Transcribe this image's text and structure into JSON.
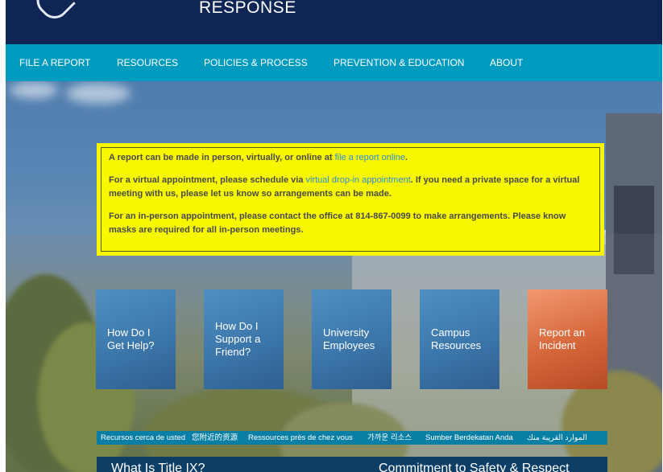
{
  "header": {
    "title": "RESPONSE",
    "logo_icon": "shield-logo-icon",
    "background": "#0f2554"
  },
  "nav": {
    "background": "#019bc0",
    "items": [
      {
        "label": "FILE A REPORT"
      },
      {
        "label": "RESOURCES"
      },
      {
        "label": "POLICIES & PROCESS"
      },
      {
        "label": "PREVENTION & EDUCATION"
      },
      {
        "label": "ABOUT"
      }
    ]
  },
  "notice": {
    "background": "#f7f700",
    "p1_text": "A report can be made in person, virtually, or online at ",
    "p1_link": "file a report online",
    "p1_end": ".",
    "p2_text": "For a virtual appointment, please schedule via ",
    "p2_link": "virtual drop-in appointment",
    "p2_end": ". If you need a private space for a virtual meeting with us, please let us know so arrangements can be made.",
    "p3_text": "For an in-person appointment, please contact the office at 814-867-0099 to make arrangements.  Please know masks are required for all in-person meetings."
  },
  "tiles": [
    {
      "label": "How Do I\nGet Help?",
      "color": "blue"
    },
    {
      "label": "How Do I\nSupport a\nFriend?",
      "color": "blue"
    },
    {
      "label": "University\nEmployees",
      "color": "blue"
    },
    {
      "label": "Campus\nResources",
      "color": "blue"
    },
    {
      "label": "Report an\nIncident",
      "color": "orange"
    }
  ],
  "languages": [
    "Recursos cerca de usted",
    "您附近的资源",
    "Ressources près de chez vous",
    "가까운 리소스",
    "Sumber Berdekatan Anda",
    "الموارد القريبة منك"
  ],
  "bottom": {
    "left_text": "What Is Title IX?",
    "right_text": "Commitment to Safety & Respect"
  }
}
